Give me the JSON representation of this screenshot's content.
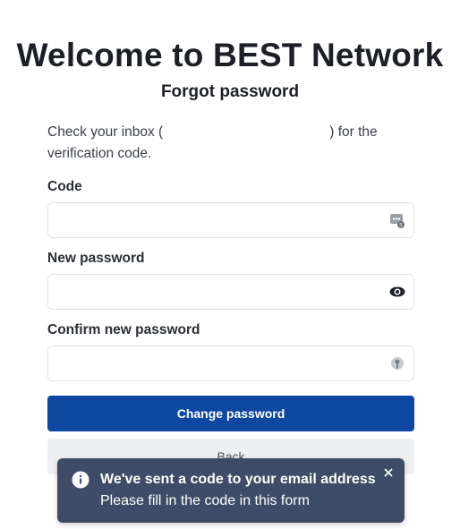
{
  "header": {
    "title": "Welcome to BEST Network",
    "subtitle": "Forgot password"
  },
  "info": {
    "prefix": "Check your inbox (",
    "suffix": ") for the verification code."
  },
  "form": {
    "code": {
      "label": "Code",
      "value": "",
      "icon": "dots-keypad-icon"
    },
    "new_password": {
      "label": "New password",
      "value": "",
      "icon": "eye-icon"
    },
    "confirm_password": {
      "label": "Confirm new password",
      "value": "",
      "icon": "key-icon"
    }
  },
  "buttons": {
    "submit_label": "Change password",
    "back_label": "Back"
  },
  "toast": {
    "title": "We've sent a code to your email address",
    "message": "Please fill in the code in this form",
    "icon": "info-icon"
  },
  "colors": {
    "primary": "#0d47a1",
    "toast_bg": "#3e4c67",
    "back_bg": "#eeeff1"
  }
}
